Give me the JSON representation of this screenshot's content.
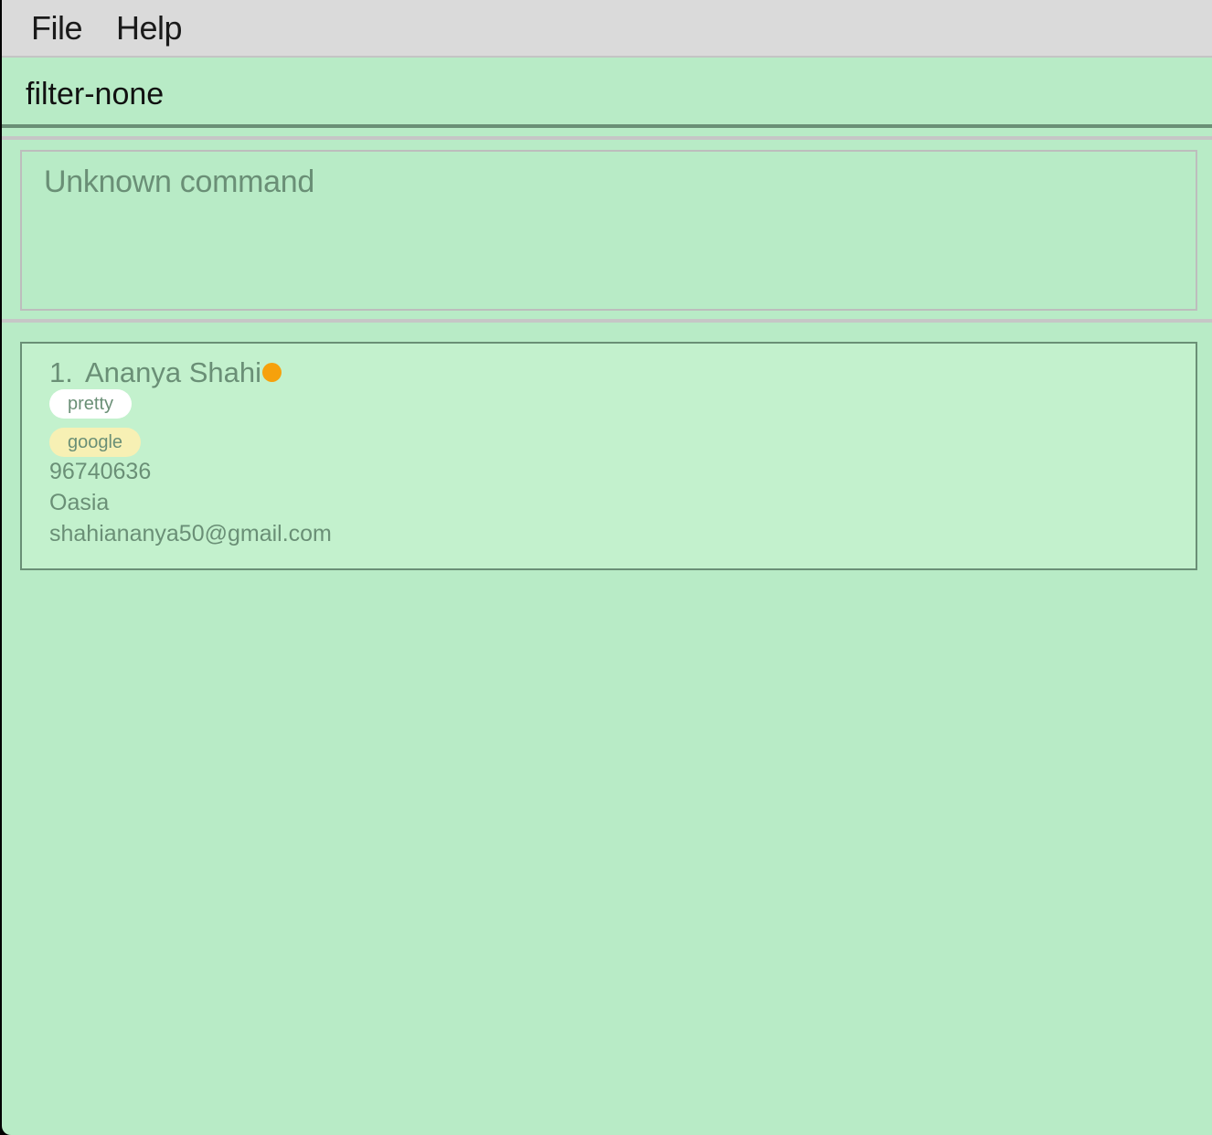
{
  "menu": {
    "file_label": "File",
    "help_label": "Help"
  },
  "command": {
    "value": "filter-none"
  },
  "result": {
    "message": "Unknown command"
  },
  "persons": [
    {
      "index": "1.",
      "name": "Ananya Shahi",
      "status_color": "#f6a10c",
      "tags": [
        "pretty",
        "google"
      ],
      "tag_colors": [
        "#ffffff",
        "#f7f0b4"
      ],
      "phone": "96740636",
      "address": "Oasia",
      "email": "shahiananya50@gmail.com"
    }
  ],
  "colors": {
    "background": "#b8ebc6",
    "card_background": "#c3f1cd",
    "text_muted": "#6a8f76",
    "menubar": "#dadada"
  }
}
